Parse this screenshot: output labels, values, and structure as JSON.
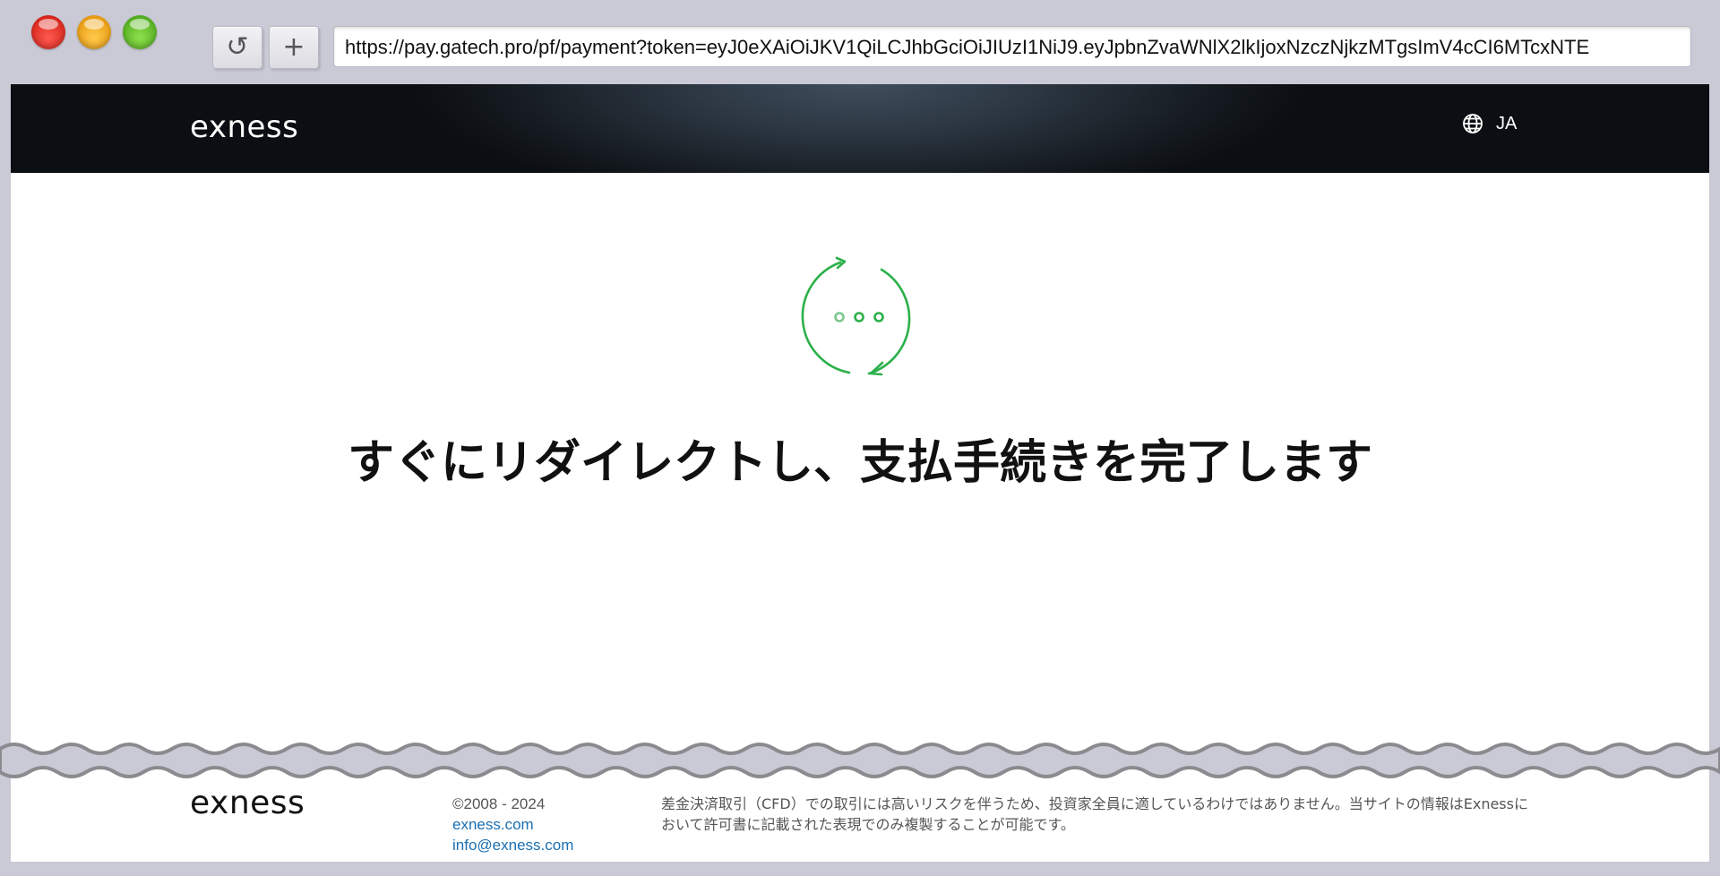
{
  "browser": {
    "url": "https://pay.gatech.pro/pf/payment?token=eyJ0eXAiOiJKV1QiLCJhbGciOiJIUzI1NiJ9.eyJpbnZvaWNlX2lkIjoxNzczNjkzMTgsImV4cCI6MTcxNTE",
    "reload_symbol": "↺",
    "new_tab_symbol": "+"
  },
  "header": {
    "logo_text": "exness",
    "language": "JA"
  },
  "main": {
    "message": "すぐにリダイレクトし、支払手続きを完了します"
  },
  "footer": {
    "logo_text": "exness",
    "copyright": "©2008 - 2024",
    "site_link": "exness.com",
    "email_link": "info@exness.com",
    "disclaimer": "差金決済取引（CFD）での取引には高いリスクを伴うため、投資家全員に適しているわけではありません。当サイトの情報はExnessにおいて許可書に記載された表現でのみ複製することが可能です。"
  },
  "colors": {
    "accent_green": "#2cb04a",
    "link_blue": "#1a6fb3"
  },
  "icons": [
    "reload-icon",
    "plus-icon",
    "globe-icon",
    "redirect-spinner-icon"
  ]
}
